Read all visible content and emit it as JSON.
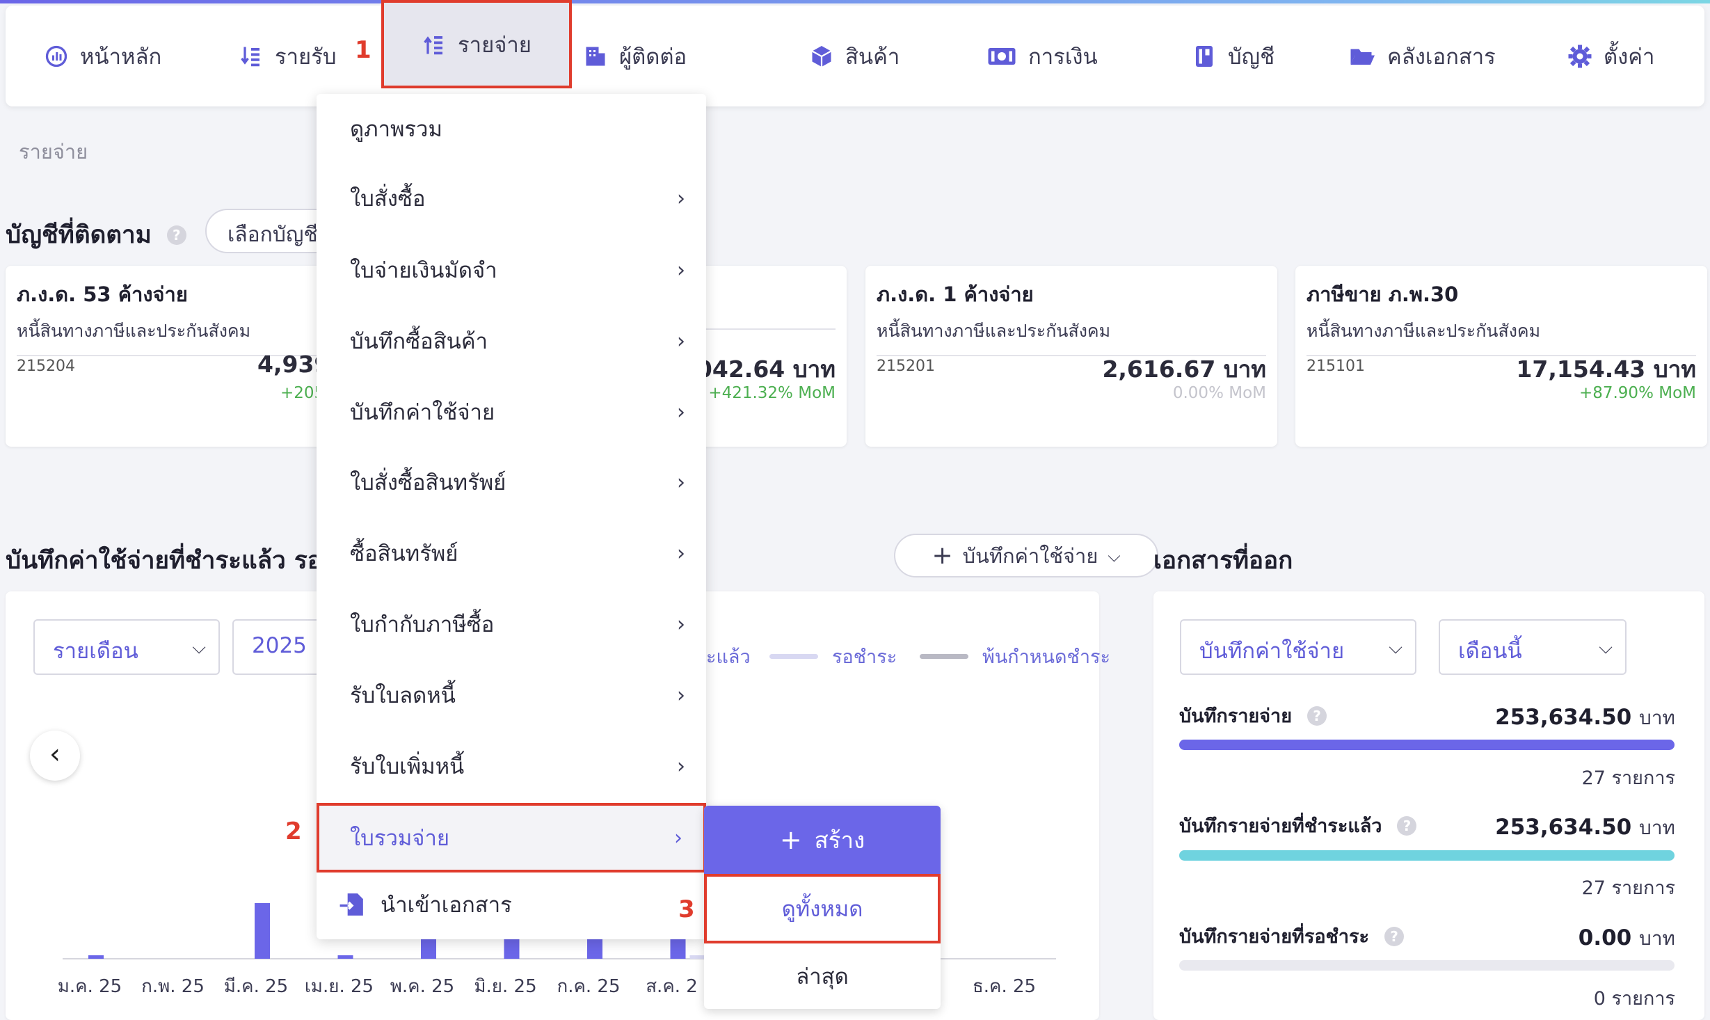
{
  "nav": {
    "home": "หน้าหลัก",
    "income": "รายรับ",
    "expense": "รายจ่าย",
    "contacts": "ผู้ติดต่อ",
    "products": "สินค้า",
    "finance": "การเงิน",
    "accounting": "บัญชี",
    "documents": "คลังเอกสาร",
    "settings": "ตั้งค่า"
  },
  "steps": {
    "one": "1",
    "two": "2",
    "three": "3"
  },
  "breadcrumb": "รายจ่าย",
  "tracked": {
    "title": "บัญชีที่ติดตาม",
    "select_label": "เลือกบัญชี"
  },
  "cards": [
    {
      "title": "ภ.ง.ด. 53 ค้างจ่าย",
      "subtitle": "หนี้สินทางภาษีและประกันสังคม",
      "code": "215204",
      "amount": "4,939",
      "mom": "+205"
    },
    {
      "title": "",
      "subtitle": "",
      "code": "",
      "amount": ",042.64 บาท",
      "mom": "+421.32% MoM"
    },
    {
      "title": "ภ.ง.ด. 1 ค้างจ่าย",
      "subtitle": "หนี้สินทางภาษีและประกันสังคม",
      "code": "215201",
      "amount": "2,616.67 บาท",
      "mom": "0.00% MoM"
    },
    {
      "title": "ภาษีขาย ภ.พ.30",
      "subtitle": "หนี้สินทางภาษีและประกันสังคม",
      "code": "215101",
      "amount": "17,154.43 บาท",
      "mom": "+87.90% MoM"
    }
  ],
  "expense_section": {
    "title": "บันทึกค่าใช้จ่ายที่ชำระแล้ว รอชำ",
    "record_button": "บันทึกค่าใช้จ่าย",
    "period": "รายเดือน",
    "year": "2025",
    "legend": [
      "ะแล้ว",
      "รอชำระ",
      "พ้นกำหนดชำระ"
    ]
  },
  "chart_data": {
    "type": "bar",
    "categories": [
      "ม.ค. 25",
      "ก.พ. 25",
      "มี.ค. 25",
      "เม.ย. 25",
      "พ.ค. 25",
      "มิ.ย. 25",
      "ก.ค. 25",
      "ส.ค. 2",
      "",
      "",
      "25",
      "ธ.ค. 25"
    ],
    "series": [
      {
        "values": [
          1,
          0,
          16,
          1,
          8,
          8,
          8,
          8,
          0,
          0,
          0,
          0
        ]
      },
      {
        "values": [
          0,
          0,
          0,
          0,
          0,
          0,
          0,
          1,
          0,
          0,
          0,
          0
        ]
      }
    ],
    "colors": [
      "#6b66e8",
      "#d8d8f2"
    ]
  },
  "documents": {
    "title": "เอกสารที่ออก",
    "filter_type": "บันทึกค่าใช้จ่าย",
    "filter_period": "เดือนนี้",
    "rows": [
      {
        "label": "บันทึกรายจ่าย",
        "amount": "253,634.50",
        "unit": "บาท",
        "count": "27 รายการ",
        "fill": 1.0,
        "color": "#6b66e8"
      },
      {
        "label": "บันทึกรายจ่ายที่ชำระแล้ว",
        "amount": "253,634.50",
        "unit": "บาท",
        "count": "27 รายการ",
        "fill": 1.0,
        "color": "#6fd3df"
      },
      {
        "label": "บันทึกรายจ่ายที่รอชำระ",
        "amount": "0.00",
        "unit": "บาท",
        "count": "0 รายการ",
        "fill": 0.0,
        "color": "#e9e9ef"
      }
    ]
  },
  "menu": {
    "items": [
      "ดูภาพรวม",
      "ใบสั่งซื้อ",
      "ใบจ่ายเงินมัดจำ",
      "บันทึกซื้อสินค้า",
      "บันทึกค่าใช้จ่าย",
      "ใบสั่งซื้อสินทรัพย์",
      "ซื้อสินทรัพย์",
      "ใบกำกับภาษีซื้อ",
      "รับใบลดหนี้",
      "รับใบเพิ่มหนี้",
      "ใบรวมจ่าย"
    ],
    "import": "นำเข้าเอกสาร"
  },
  "submenu": {
    "create": "สร้าง",
    "view_all": "ดูทั้งหมด",
    "latest": "ล่าสุด"
  }
}
